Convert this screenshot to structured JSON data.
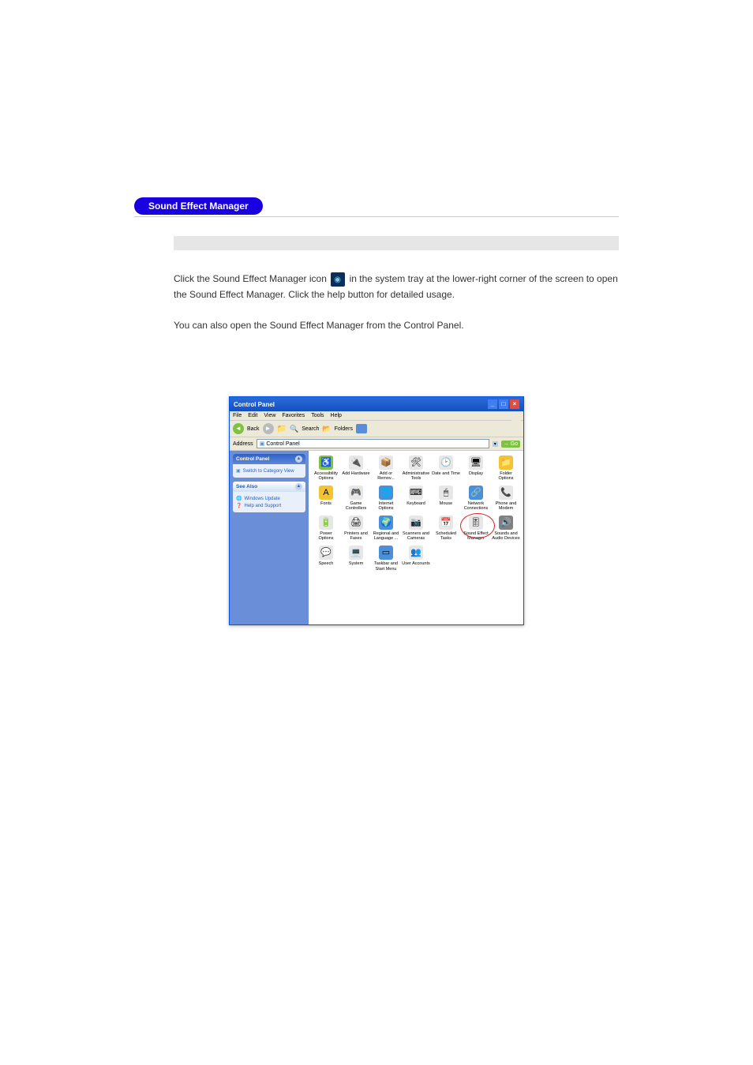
{
  "section_title": "Sound Effect Manager",
  "paragraphs": {
    "p1": "Click the Sound Effect Manager icon ",
    "p1b": " in the system tray at the lower-right corner of the screen to open the Sound Effect Manager. Click the help button for detailed usage.",
    "p2": "You can also open the Sound Effect Manager from the Control Panel."
  },
  "window": {
    "title": "Control Panel",
    "menus": [
      "File",
      "Edit",
      "View",
      "Favorites",
      "Tools",
      "Help"
    ],
    "toolbar": {
      "back": "Back",
      "search": "Search",
      "folders": "Folders"
    },
    "address_label": "Address",
    "address_value": "Control Panel",
    "go": "Go",
    "left_pane": {
      "header": "Control Panel",
      "switch_link": "Switch to Category View",
      "see_also": "See Also",
      "links": [
        "Windows Update",
        "Help and Support"
      ]
    },
    "items": [
      {
        "label": "Accessibility Options",
        "glyph": "♿",
        "bg": "#7fc142"
      },
      {
        "label": "Add Hardware",
        "glyph": "🔌",
        "bg": "#e7e7e7"
      },
      {
        "label": "Add or Remov...",
        "glyph": "📦",
        "bg": "#e7e7e7"
      },
      {
        "label": "Administrative Tools",
        "glyph": "🛠",
        "bg": "#e7e7e7"
      },
      {
        "label": "Date and Time",
        "glyph": "🕑",
        "bg": "#e7e7e7"
      },
      {
        "label": "Display",
        "glyph": "🖥",
        "bg": "#e7e7e7"
      },
      {
        "label": "Folder Options",
        "glyph": "📁",
        "bg": "#f4c430"
      },
      {
        "label": "Fonts",
        "glyph": "A",
        "bg": "#f4c430"
      },
      {
        "label": "Game Controllers",
        "glyph": "🎮",
        "bg": "#e7e7e7"
      },
      {
        "label": "Internet Options",
        "glyph": "🌐",
        "bg": "#4a90d9"
      },
      {
        "label": "Keyboard",
        "glyph": "⌨",
        "bg": "#e7e7e7"
      },
      {
        "label": "Mouse",
        "glyph": "🖱",
        "bg": "#e7e7e7"
      },
      {
        "label": "Network Connections",
        "glyph": "🔗",
        "bg": "#4a90d9"
      },
      {
        "label": "Phone and Modem",
        "glyph": "📞",
        "bg": "#e7e7e7"
      },
      {
        "label": "Power Options",
        "glyph": "🔋",
        "bg": "#e7e7e7"
      },
      {
        "label": "Printers and Faxes",
        "glyph": "🖨",
        "bg": "#e7e7e7"
      },
      {
        "label": "Regional and Language ...",
        "glyph": "🌍",
        "bg": "#4a90d9"
      },
      {
        "label": "Scanners and Cameras",
        "glyph": "📷",
        "bg": "#e7e7e7"
      },
      {
        "label": "Scheduled Tasks",
        "glyph": "📅",
        "bg": "#e7e7e7"
      },
      {
        "label": "Sound Effect Manager",
        "glyph": "🎚",
        "bg": "#e7e7e7",
        "highlight": true
      },
      {
        "label": "Sounds and Audio Devices",
        "glyph": "🔊",
        "bg": "#808080"
      },
      {
        "label": "Speech",
        "glyph": "💬",
        "bg": "#e7e7e7"
      },
      {
        "label": "System",
        "glyph": "💻",
        "bg": "#e7e7e7"
      },
      {
        "label": "Taskbar and Start Menu",
        "glyph": "▭",
        "bg": "#4a90d9"
      },
      {
        "label": "User Accounts",
        "glyph": "👥",
        "bg": "#e7e7e7"
      }
    ]
  }
}
